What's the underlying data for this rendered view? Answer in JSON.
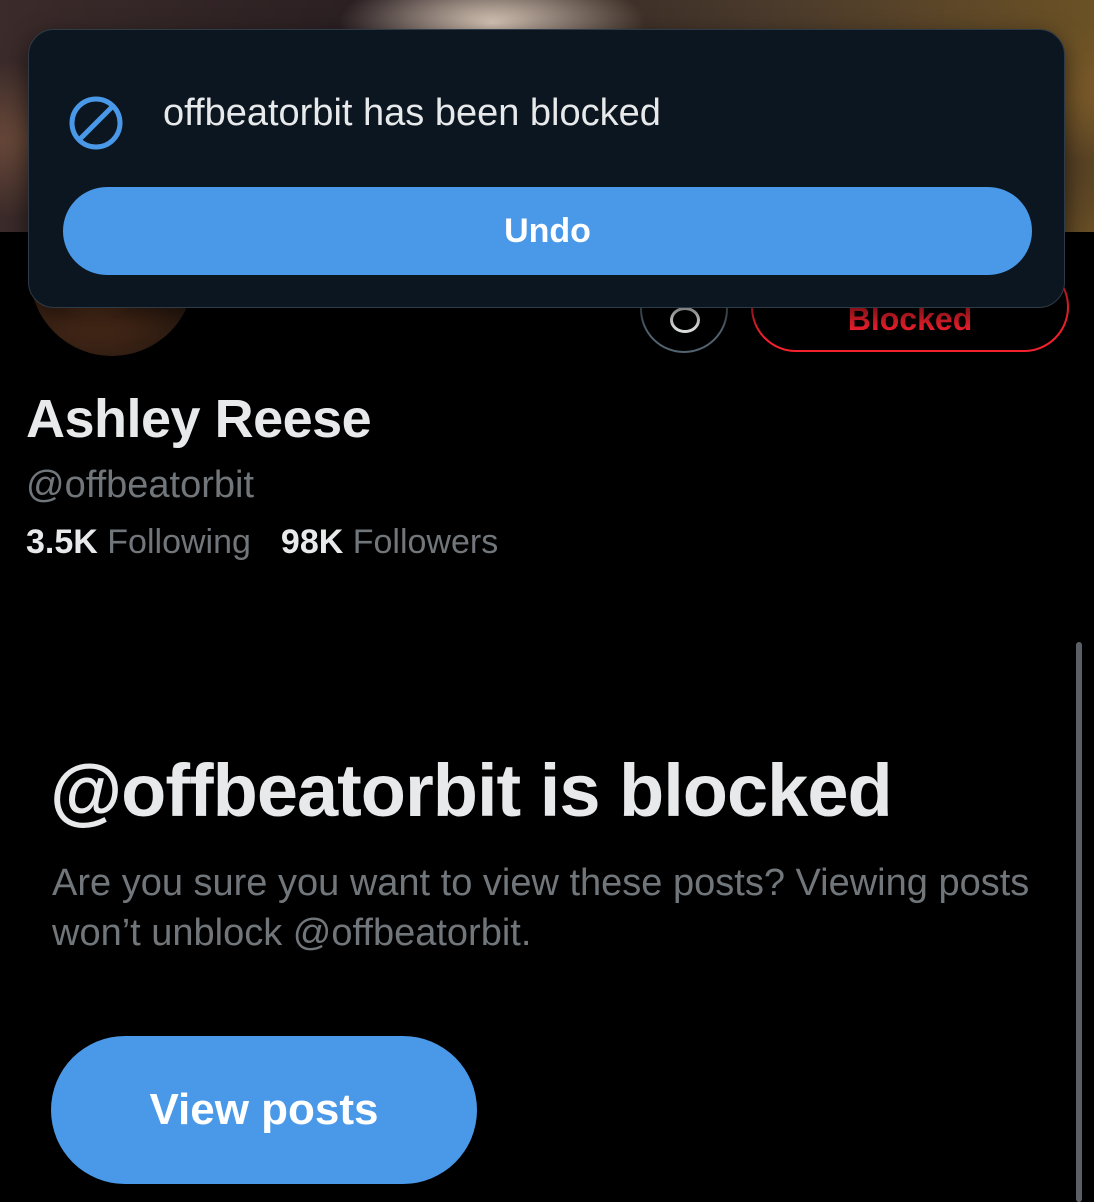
{
  "toast": {
    "message": "offbeatorbit has been blocked",
    "icon": "block-icon",
    "undo_label": "Undo"
  },
  "profile": {
    "name": "Ashley Reese",
    "handle": "@offbeatorbit",
    "following_count": "3.5K",
    "following_label": "Following",
    "followers_count": "98K",
    "followers_label": "Followers",
    "blocked_button_label": "Blocked"
  },
  "blocked_notice": {
    "title": "@offbeatorbit is blocked",
    "description": "Are you sure you want to view these posts? Viewing posts won’t unblock @offbeatorbit.",
    "button_label": "View posts"
  },
  "colors": {
    "accent": "#4a99e9",
    "danger": "#f4212e",
    "background": "#000000",
    "muted_text": "#71767b"
  }
}
